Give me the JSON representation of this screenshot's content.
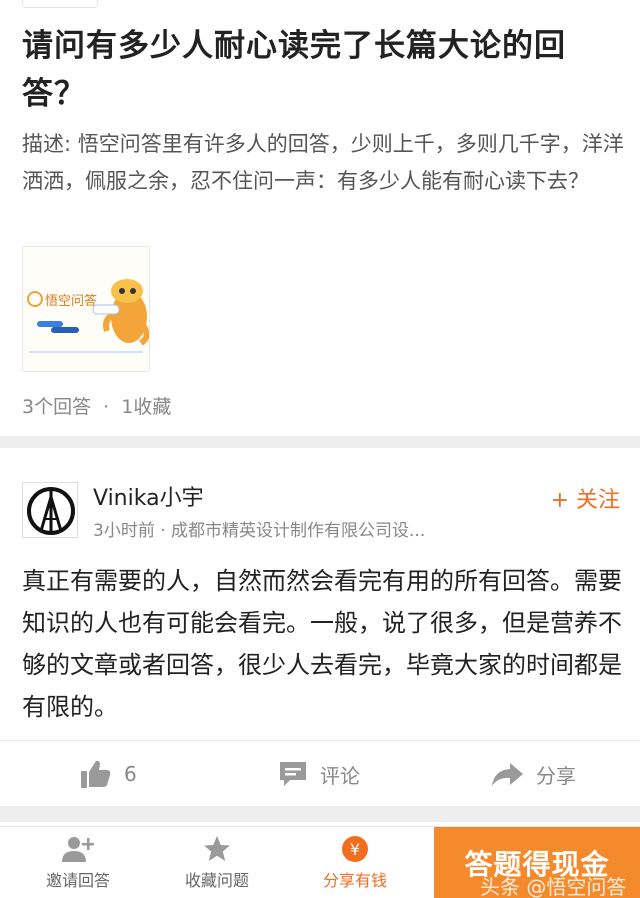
{
  "question": {
    "title": "请问有多少人耐心读完了长篇大论的回答？",
    "description": "描述: 悟空问答里有许多人的回答，少则上千，多则几千字，洋洋洒洒，佩服之余，忍不住问一声：有多少人能有耐心读下去？",
    "thumbnail_logo_text": "悟空问答",
    "answers_count": "3个回答",
    "dot": "·",
    "favorites_count": "1收藏"
  },
  "answer": {
    "author": "Vinika小宇",
    "byline": "3小时前 · 成都市精英设计制作有限公司设...",
    "follow_label": "+ 关注",
    "content": "真正有需要的人，自然而然会看完有用的所有回答。需要知识的人也有可能会看完。一般，说了很多，但是营养不够的文章或者回答，很少人去看完，毕竟大家的时间都是有限的。",
    "like_count": "6",
    "comment_label": "评论",
    "share_label": "分享"
  },
  "bottom_bar": {
    "tabs": [
      {
        "label": "邀请回答",
        "icon": "add-user-icon"
      },
      {
        "label": "收藏问题",
        "icon": "star-icon"
      },
      {
        "label": "分享有钱",
        "icon": "yen-icon"
      }
    ],
    "yen_symbol": "¥",
    "cta_label": "答题得现金",
    "watermark": "头条 @悟空问答"
  },
  "colors": {
    "accent": "#f26d1f",
    "cta_bg": "#f58a2c",
    "separator": "#eeeeee"
  }
}
